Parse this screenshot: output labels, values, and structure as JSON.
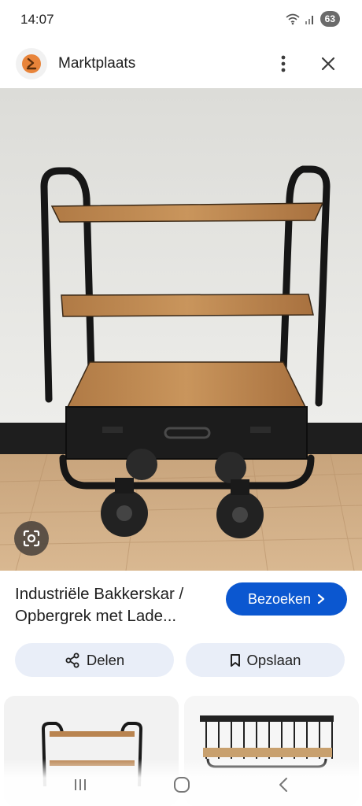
{
  "status_bar": {
    "time": "14:07",
    "battery": "63",
    "icons": [
      "wifi-icon",
      "signal-icon",
      "battery-icon"
    ]
  },
  "header": {
    "site_name": "Marktplaats",
    "logo_icon": "marktplaats-logo-icon",
    "menu_icon": "more-vert-icon",
    "close_icon": "close-icon"
  },
  "result": {
    "title_line1": "Industriële Bakkerskar /",
    "title_line2": "Opbergrek met Lade...",
    "visit_label": "Bezoeken",
    "share_label": "Delen",
    "save_label": "Opslaan"
  },
  "colors": {
    "accent": "#0b57d0",
    "pill_bg": "#e9eef8",
    "logo_orange": "#e8843a"
  },
  "navigation": {
    "icons": [
      "recent-apps-icon",
      "home-icon",
      "back-icon"
    ]
  }
}
